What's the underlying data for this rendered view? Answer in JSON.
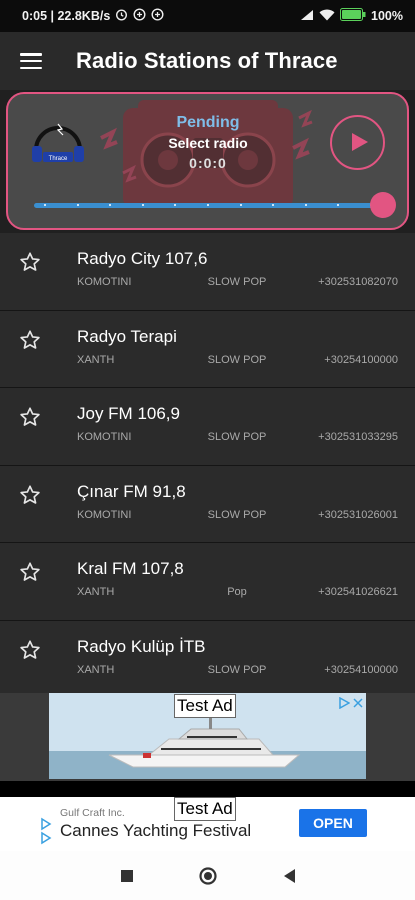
{
  "statusbar": {
    "time_speed": "0:05 | 22.8KB/s",
    "battery": "100"
  },
  "appbar": {
    "title": "Radio Stations of Thrace"
  },
  "player": {
    "status": "Pending",
    "prompt": "Select radio",
    "elapsed": "0:0:0",
    "logo_text": "Thrace",
    "progress": 1.0
  },
  "stations": [
    {
      "name": "Radyo City 107,6",
      "city": "KOMOTINI",
      "genre": "SLOW POP",
      "phone": "+302531082070"
    },
    {
      "name": "Radyo Terapi",
      "city": "XANTH",
      "genre": "SLOW POP",
      "phone": "+30254100000"
    },
    {
      "name": "Joy FM 106,9",
      "city": "KOMOTINI",
      "genre": "SLOW POP",
      "phone": "+302531033295"
    },
    {
      "name": "Çınar FM 91,8",
      "city": "KOMOTINI",
      "genre": "SLOW POP",
      "phone": "+302531026001"
    },
    {
      "name": "Kral FM 107,8",
      "city": "XANTH",
      "genre": "Pop",
      "phone": "+302541026621"
    },
    {
      "name": "Radyo Kulüp İTB",
      "city": "XANTH",
      "genre": "SLOW POP",
      "phone": "+30254100000"
    }
  ],
  "ad_banner": {
    "label": "Test Ad"
  },
  "ad_bottom": {
    "label": "Test Ad",
    "advertiser": "Gulf Craft Inc.",
    "headline": "Cannes Yachting Festival",
    "cta": "OPEN"
  },
  "colors": {
    "accent": "#e25582",
    "seek": "#3a8fd0",
    "pending": "#7fbde8",
    "cta": "#1a73e8"
  }
}
